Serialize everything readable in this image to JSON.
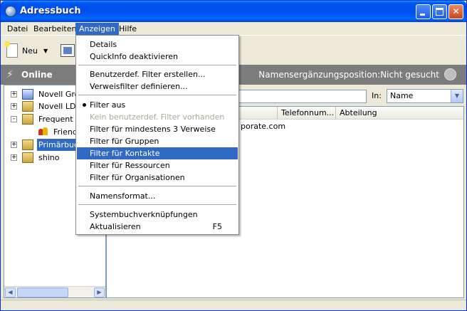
{
  "window": {
    "title": "Adressbuch"
  },
  "menubar": {
    "items": [
      "Datei",
      "Bearbeiten",
      "Anzeigen",
      "Hilfe"
    ],
    "active_index": 2
  },
  "toolbar": {
    "new_label": "Neu"
  },
  "online_bar": {
    "status": "Online",
    "namens_text": "Namensergänzungsposition:Nicht gesucht"
  },
  "tree": {
    "items": [
      {
        "label": "Novell Grou",
        "expander": "+",
        "icon": "blue-book-icon"
      },
      {
        "label": "Novell LDA",
        "expander": "+",
        "icon": "book-icon"
      },
      {
        "label": "Frequent C",
        "expander": "-",
        "icon": "book-icon"
      },
      {
        "label": "Friends",
        "expander": "",
        "icon": "users-icon"
      },
      {
        "label": "Primärbuch",
        "expander": "+",
        "icon": "book-icon",
        "selected": true
      },
      {
        "label": "shino",
        "expander": "+",
        "icon": "book-icon"
      }
    ]
  },
  "search": {
    "in_label": "In:",
    "in_value": "Name"
  },
  "list": {
    "columns": [
      "",
      "Telefonnum...",
      "Abteilung"
    ],
    "row_text": "porate.com"
  },
  "anzeigen_menu": {
    "items": [
      {
        "label": "Details",
        "type": "item"
      },
      {
        "label": "QuickInfo deaktivieren",
        "type": "item"
      },
      {
        "type": "separator"
      },
      {
        "label": "Benutzerdef. Filter erstellen...",
        "type": "item"
      },
      {
        "label": "Verweisfilter definieren...",
        "type": "item"
      },
      {
        "type": "separator"
      },
      {
        "label": "Filter aus",
        "type": "item",
        "checked": true
      },
      {
        "label": "Kein benutzerdef. Filter vorhanden",
        "type": "item",
        "disabled": true
      },
      {
        "label": "Filter für mindestens 3 Verweise",
        "type": "item"
      },
      {
        "label": "Filter für Gruppen",
        "type": "item"
      },
      {
        "label": "Filter für Kontakte",
        "type": "item",
        "highlighted": true
      },
      {
        "label": "Filter für Ressourcen",
        "type": "item"
      },
      {
        "label": "Filter für Organisationen",
        "type": "item"
      },
      {
        "type": "separator"
      },
      {
        "label": "Namensformat...",
        "type": "item"
      },
      {
        "type": "separator"
      },
      {
        "label": "Systembuchverknüpfungen",
        "type": "item"
      },
      {
        "label": "Aktualisieren",
        "type": "item",
        "shortcut": "F5"
      }
    ]
  },
  "colors": {
    "titlebar": "#0053ee",
    "highlight": "#316ac5",
    "online_bar": "#7c7c7c"
  }
}
